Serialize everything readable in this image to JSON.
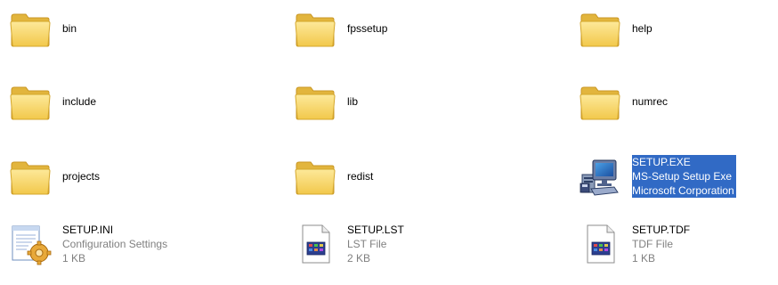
{
  "window": {
    "view": "Tiles"
  },
  "colors": {
    "selection": "#316ac5",
    "folder_fill": "#f8d563",
    "folder_edge": "#d4a72c",
    "detail_text": "#808080"
  },
  "items": [
    {
      "name": "bin",
      "type": "folder",
      "icon": "folder-icon"
    },
    {
      "name": "fpssetup",
      "type": "folder",
      "icon": "folder-icon"
    },
    {
      "name": "help",
      "type": "folder",
      "icon": "folder-icon"
    },
    {
      "name": "include",
      "type": "folder",
      "icon": "folder-icon"
    },
    {
      "name": "lib",
      "type": "folder",
      "icon": "folder-icon"
    },
    {
      "name": "numrec",
      "type": "folder",
      "icon": "folder-icon"
    },
    {
      "name": "projects",
      "type": "folder",
      "icon": "folder-icon"
    },
    {
      "name": "redist",
      "type": "folder",
      "icon": "folder-icon"
    },
    {
      "name": "SETUP.EXE",
      "line2": "MS-Setup Setup Exe",
      "line3": "Microsoft Corporation",
      "type": "exe",
      "icon": "setup-computer-icon",
      "selected": true
    },
    {
      "name": "SETUP.INI",
      "line2": "Configuration Settings",
      "line3": "1 KB",
      "type": "ini",
      "icon": "config-settings-icon"
    },
    {
      "name": "SETUP.LST",
      "line2": "LST File",
      "line3": "2 KB",
      "type": "file",
      "icon": "document-icon"
    },
    {
      "name": "SETUP.TDF",
      "line2": "TDF File",
      "line3": "1 KB",
      "type": "file",
      "icon": "document-icon"
    }
  ]
}
